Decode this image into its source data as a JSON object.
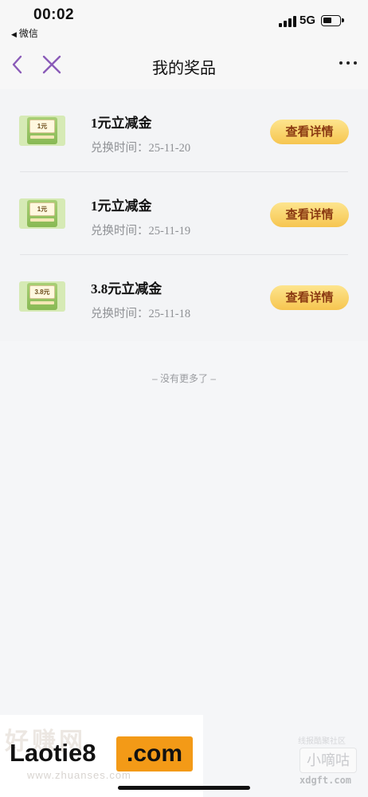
{
  "status_bar": {
    "time": "00:02",
    "back_app": "微信",
    "network": "5G"
  },
  "nav": {
    "title": "我的奖品",
    "back_icon": "chevron-left-icon",
    "close_icon": "close-icon",
    "more_icon": "more-dots-icon",
    "accent_color": "#8a5bb8"
  },
  "prizes": [
    {
      "name": "1元立减金",
      "time_label": "兑换时间：",
      "time": "25-11-20",
      "coupon_value": "1元",
      "button": "查看详情"
    },
    {
      "name": "1元立减金",
      "time_label": "兑换时间：",
      "time": "25-11-19",
      "coupon_value": "1元",
      "button": "查看详情"
    },
    {
      "name": "3.8元立减金",
      "time_label": "兑换时间：",
      "time": "25-11-18",
      "coupon_value": "3.8元",
      "button": "查看详情"
    }
  ],
  "footer": {
    "no_more": "– 没有更多了 –"
  },
  "watermarks": {
    "left_brand": "Laotie8",
    "left_domain": ".com",
    "left_url": "www.zhuanses.com",
    "right_caption": "线报酷聚社区",
    "right_brand": "小嘀咕",
    "right_url": "xdgft.com"
  },
  "colors": {
    "button_gradient_top": "#fde58e",
    "button_gradient_bottom": "#f6c550",
    "button_text": "#8b3a12"
  }
}
